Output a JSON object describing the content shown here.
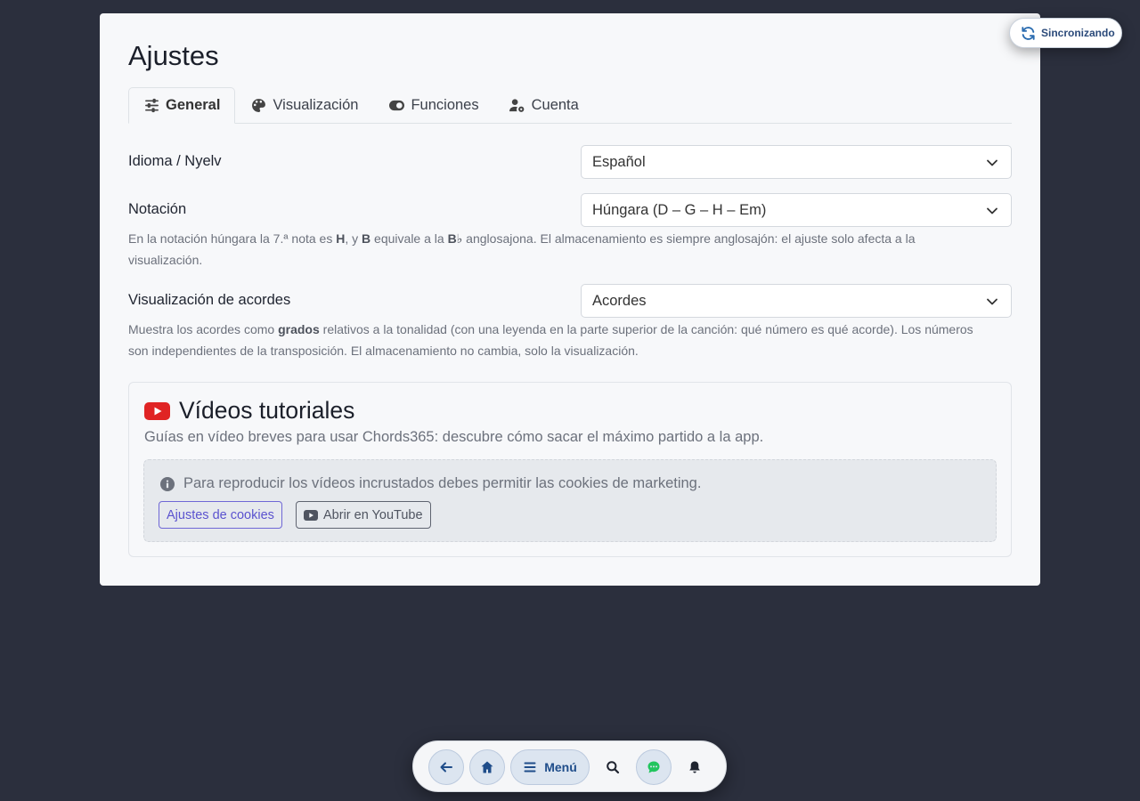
{
  "page": {
    "title": "Ajustes"
  },
  "tabs": [
    {
      "label": "General",
      "icon": "sliders-icon",
      "active": true
    },
    {
      "label": "Visualización",
      "icon": "palette-icon",
      "active": false
    },
    {
      "label": "Funciones",
      "icon": "toggle-icon",
      "active": false
    },
    {
      "label": "Cuenta",
      "icon": "user-gear-icon",
      "active": false
    }
  ],
  "settings": {
    "language": {
      "label": "Idioma / Nyelv",
      "value": "Español"
    },
    "notation": {
      "label": "Notación",
      "value": "Húngara (D – G – H – Em)",
      "help_1": "En la notación húngara la 7.ª nota es ",
      "help_h": "H",
      "help_2": ", y ",
      "help_b": "B",
      "help_3": " equivale a la ",
      "help_bb": "B♭",
      "help_4": " anglosajona. El almacenamiento es siempre anglosajón: el ajuste solo afecta a la visualización."
    },
    "chords": {
      "label": "Visualización de acordes",
      "value": "Acordes",
      "help_1": "Muestra los acordes como ",
      "help_bold": "grados",
      "help_2": " relativos a la tonalidad (con una leyenda en la parte superior de la canción: qué número es qué acorde). Los números son independientes de la transposición. El almacenamiento no cambia, solo la visualización."
    }
  },
  "videos": {
    "title": "Vídeos tutoriales",
    "description": "Guías en vídeo breves para usar Chords365: descubre cómo sacar el máximo partido a la app.",
    "cookie_notice": "Para reproducir los vídeos incrustados debes permitir las cookies de marketing.",
    "cookie_settings_label": "Ajustes de cookies",
    "youtube_label": "Abrir en YouTube"
  },
  "sync": {
    "label": "Sincronizando"
  },
  "dock": {
    "menu_label": "Menú"
  },
  "colors": {
    "youtube_red": "#e02424",
    "accent": "#5b53cf",
    "dock_blue": "#1f4d8a",
    "chat_green": "#22c55e"
  }
}
